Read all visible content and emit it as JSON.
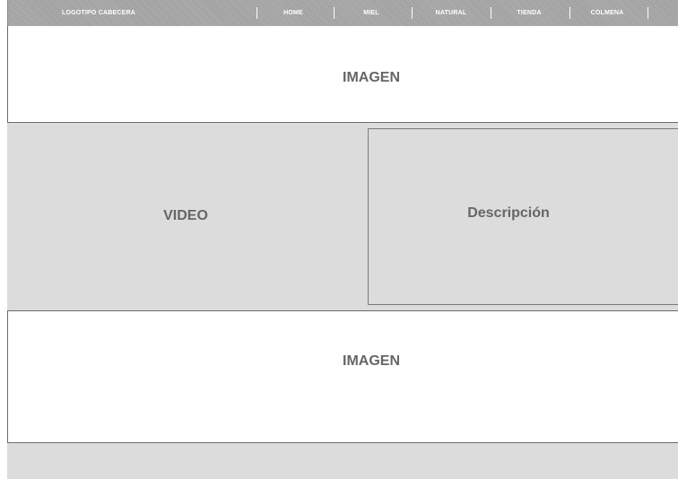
{
  "header": {
    "logo_text": "LOGOTIPO CABECERA",
    "nav_items": [
      {
        "label": "HOME"
      },
      {
        "label": "MIEL"
      },
      {
        "label": "NATURAL"
      },
      {
        "label": "TIENDA"
      },
      {
        "label": "COLMENA"
      }
    ]
  },
  "main": {
    "top_image_label": "IMAGEN",
    "video_label": "VIDEO",
    "description_label": "Descripción",
    "bottom_image_label": "IMAGEN"
  },
  "colors": {
    "nav_background": "#a3a3a3",
    "panel_gray": "#dcdcdc",
    "label_gray": "#666666",
    "border_gray": "#6c6c6c"
  }
}
